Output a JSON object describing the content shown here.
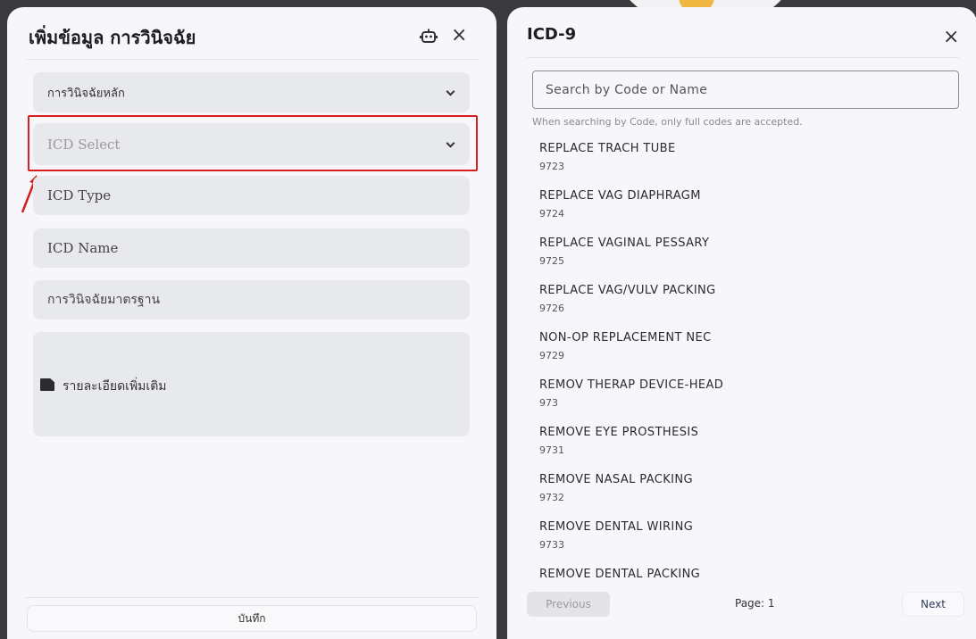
{
  "left_panel": {
    "title": "เพิ่มข้อมูล การวินิจฉัย",
    "main_diagnosis_label": "การวินิจฉัยหลัก",
    "icd_select_placeholder": "ICD Select",
    "icd_type_placeholder": "ICD Type",
    "icd_name_placeholder": "ICD Name",
    "standard_diagnosis_placeholder": "การวินิจฉัยมาตรฐาน",
    "additional_details_label": "รายละเอียดเพิ่มเติม",
    "save_label": "บันทึก",
    "highlight_color": "#d91e1e"
  },
  "right_panel": {
    "title": "ICD-9",
    "search_placeholder": "Search by Code or Name",
    "search_hint": "When searching by Code, only full codes are accepted.",
    "results": [
      {
        "name": "REPLACE TRACH TUBE",
        "code": "9723"
      },
      {
        "name": "REPLACE VAG DIAPHRAGM",
        "code": "9724"
      },
      {
        "name": "REPLACE VAGINAL PESSARY",
        "code": "9725"
      },
      {
        "name": "REPLACE VAG/VULV PACKING",
        "code": "9726"
      },
      {
        "name": "NON-OP REPLACEMENT NEC",
        "code": "9729"
      },
      {
        "name": "REMOV THERAP DEVICE-HEAD",
        "code": "973"
      },
      {
        "name": "REMOVE EYE PROSTHESIS",
        "code": "9731"
      },
      {
        "name": "REMOVE NASAL PACKING",
        "code": "9732"
      },
      {
        "name": "REMOVE DENTAL WIRING",
        "code": "9733"
      },
      {
        "name": "REMOVE DENTAL PACKING",
        "code": ""
      }
    ],
    "prev_label": "Previous",
    "page_label": "Page: 1",
    "next_label": "Next"
  },
  "icons": {
    "close": "close-icon",
    "robot": "robot-icon",
    "chevron": "chevron-down-icon",
    "note": "note-icon",
    "arrow": "annotation-arrow"
  }
}
